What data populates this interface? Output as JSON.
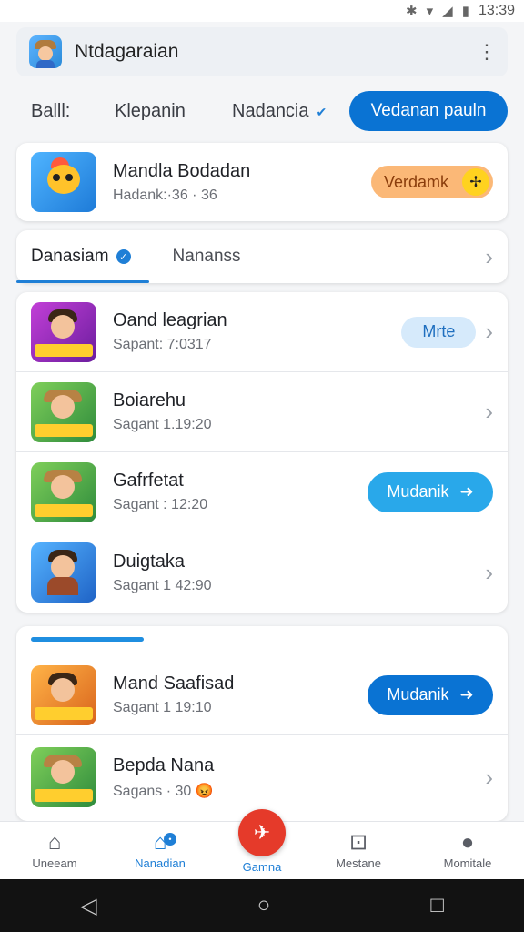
{
  "status_bar": {
    "time": "13:39",
    "icons": [
      "bluetooth-icon",
      "wifi-icon",
      "signal-icon",
      "battery-icon"
    ]
  },
  "header": {
    "title": "Ntdagaraian"
  },
  "filters": {
    "f1": "Balll:",
    "f2": "Klepanin",
    "f3": "Nadancia",
    "primary": "Vedanan pauln"
  },
  "featured": {
    "title": "Mandla Bodadan",
    "subtitle": "Hadank:·36 · 36",
    "action": "Verdamk"
  },
  "tabs": {
    "active": "Danasiam",
    "inactive": "Nananss"
  },
  "list": [
    {
      "title": "Oand leagrian",
      "subtitle": "Sapant: 7:0317",
      "action": "Mrte"
    },
    {
      "title": "Boiarehu",
      "subtitle": "Sagant 1.19:20",
      "action": ""
    },
    {
      "title": "Gafrfetat",
      "subtitle": "Sagant : 12:20",
      "action": "Mudanik"
    },
    {
      "title": "Duigtaka",
      "subtitle": "Sagant 1 42:90",
      "action": ""
    }
  ],
  "section2": [
    {
      "title": "Mand Saafisad",
      "subtitle": "Sagant 1 19:10",
      "action": "Mudanik"
    },
    {
      "title": "Bepda Nana",
      "subtitle": "Sagans · 30",
      "action": ""
    }
  ],
  "bottom_nav": {
    "n1": "Uneeam",
    "n2": "Nanadian",
    "n3": "Gamna",
    "n4": "Mestane",
    "n5": "Momitale"
  },
  "colors": {
    "accent": "#0a73d3",
    "fab": "#e53a2a",
    "orange_pill": "#fbb877"
  }
}
